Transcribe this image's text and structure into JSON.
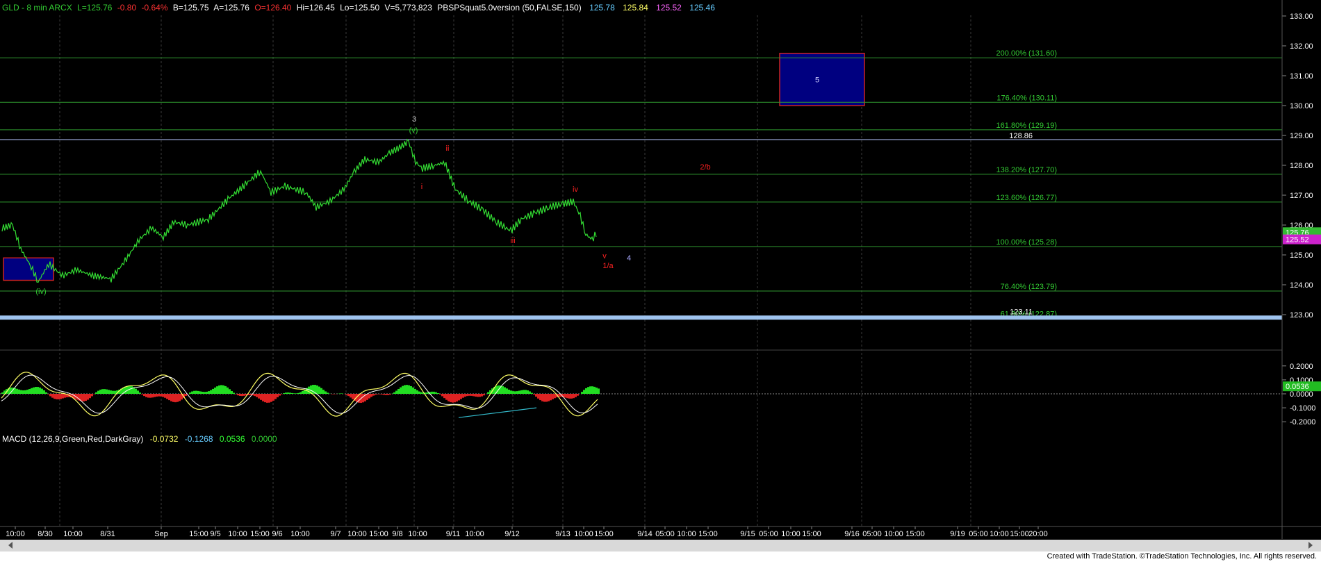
{
  "header": {
    "symbol": "GLD - 8 min  ARCX",
    "last": "L=125.76",
    "change": "-0.80",
    "pct": "-0.64%",
    "bid": "B=125.75",
    "ask": "A=125.76",
    "open": "O=126.40",
    "high": "Hi=126.45",
    "low": "Lo=125.50",
    "volume": "V=5,773,823",
    "study": "PBSPSquat5.0version (50,FALSE,150)",
    "study_values": [
      "125.78",
      "125.84",
      "125.52",
      "125.46"
    ],
    "colors": {
      "symbol": "#33cc33",
      "neg": "#ff3333",
      "text": "#ffffff"
    },
    "study_colors": [
      "#66ccff",
      "#ffff66",
      "#ff66ff",
      "#66ccff"
    ]
  },
  "price_axis": {
    "ticks": [
      "133.00",
      "132.00",
      "131.00",
      "130.00",
      "129.00",
      "128.00",
      "127.00",
      "126.00",
      "125.00",
      "124.00",
      "123.00"
    ]
  },
  "fib_levels": [
    {
      "label": "200.00% (131.60)",
      "value": 131.6
    },
    {
      "label": "176.40% (130.11)",
      "value": 130.11
    },
    {
      "label": "161.80% (129.19)",
      "value": 129.19
    },
    {
      "label": "138.20% (127.70)",
      "value": 127.7
    },
    {
      "label": "123.60% (126.77)",
      "value": 126.77
    },
    {
      "label": "100.00% (125.28)",
      "value": 125.28
    },
    {
      "label": "76.40% (123.79)",
      "value": 123.79
    },
    {
      "label": "61.80% (122.87)",
      "value": 122.87
    }
  ],
  "horizontal_levels": [
    {
      "label": "128.86",
      "value": 128.86,
      "color": "#b8c8ff"
    },
    {
      "label": "123.11",
      "value": 123.11,
      "color": "#9ec3ee"
    }
  ],
  "price_badges": [
    {
      "label": "125.76",
      "value": 125.76,
      "color": "#33bb33"
    },
    {
      "label": "125.52",
      "value": 125.52,
      "color": "#cc22cc"
    }
  ],
  "target_box": {
    "label": "5",
    "price_low": 130.0,
    "price_high": 131.75
  },
  "support_box": {
    "price_low": 124.15,
    "price_high": 124.9
  },
  "wave_labels": [
    {
      "text": "3",
      "date": "9/8",
      "price": 129.4,
      "color": "#cccccc"
    },
    {
      "text": "(v)",
      "date": "9/8",
      "price": 129.1,
      "color": "#33cc33"
    },
    {
      "text": "ii",
      "date": "9/8b",
      "price": 128.4,
      "color": "#ff2222"
    },
    {
      "text": "i",
      "date": "9/8c",
      "price": 127.3,
      "color": "#ff2222"
    },
    {
      "text": "iv",
      "date": "9/13a",
      "price": 127.2,
      "color": "#ff2222"
    },
    {
      "text": "iii",
      "date": "9/12a",
      "price": 125.8,
      "color": "#ff2222"
    },
    {
      "text": "v",
      "date": "9/13b",
      "price": 125.0,
      "color": "#ff2222"
    },
    {
      "text": "1/a",
      "date": "9/13b",
      "price": 124.65,
      "color": "#ff2222"
    },
    {
      "text": "4",
      "date": "9/13c",
      "price": 124.9,
      "color": "#aaaaff"
    },
    {
      "text": "2/b",
      "date": "9/14",
      "price": 127.85,
      "color": "#ff2222"
    },
    {
      "text": "(iv)",
      "date": "8/30",
      "price": 123.9,
      "color": "#33cc33"
    }
  ],
  "macd": {
    "title": "MACD (12,26,9,Green,Red,DarkGray)",
    "values": [
      "-0.0732",
      "-0.1268",
      "0.0536",
      "0.0000"
    ],
    "value_colors": [
      "#ffff66",
      "#66ccff",
      "#33ff33",
      "#33cc33"
    ],
    "ticks": [
      "0.2000",
      "0.1000",
      "0.0000",
      "-0.1000",
      "-0.2000"
    ],
    "badge": "0.0536"
  },
  "time_axis": {
    "labels": [
      "10:00",
      "8/30",
      "10:00",
      "8/31",
      "Sep",
      "15:00",
      "9/5",
      "10:00",
      "15:00",
      "9/6",
      "10:00",
      "9/7",
      "10:00",
      "15:00",
      "9/8",
      "10:00",
      "9/11",
      "10:00",
      "9/12",
      "9/13",
      "10:00",
      "15:00",
      "9/14",
      "05:00",
      "10:00",
      "15:00",
      "9/15",
      "05:00",
      "10:00",
      "15:00",
      "9/16",
      "05:00",
      "10:00",
      "15:00",
      "9/19",
      "05:00",
      "10:00",
      "15:00",
      "20:00"
    ]
  },
  "nav": {
    "left_icon": "scroll-left-icon",
    "right_icon": "scroll-right-icon"
  },
  "footer": {
    "credit": "Created with TradeStation. ©TradeStation Technologies, Inc. All rights reserved."
  }
}
